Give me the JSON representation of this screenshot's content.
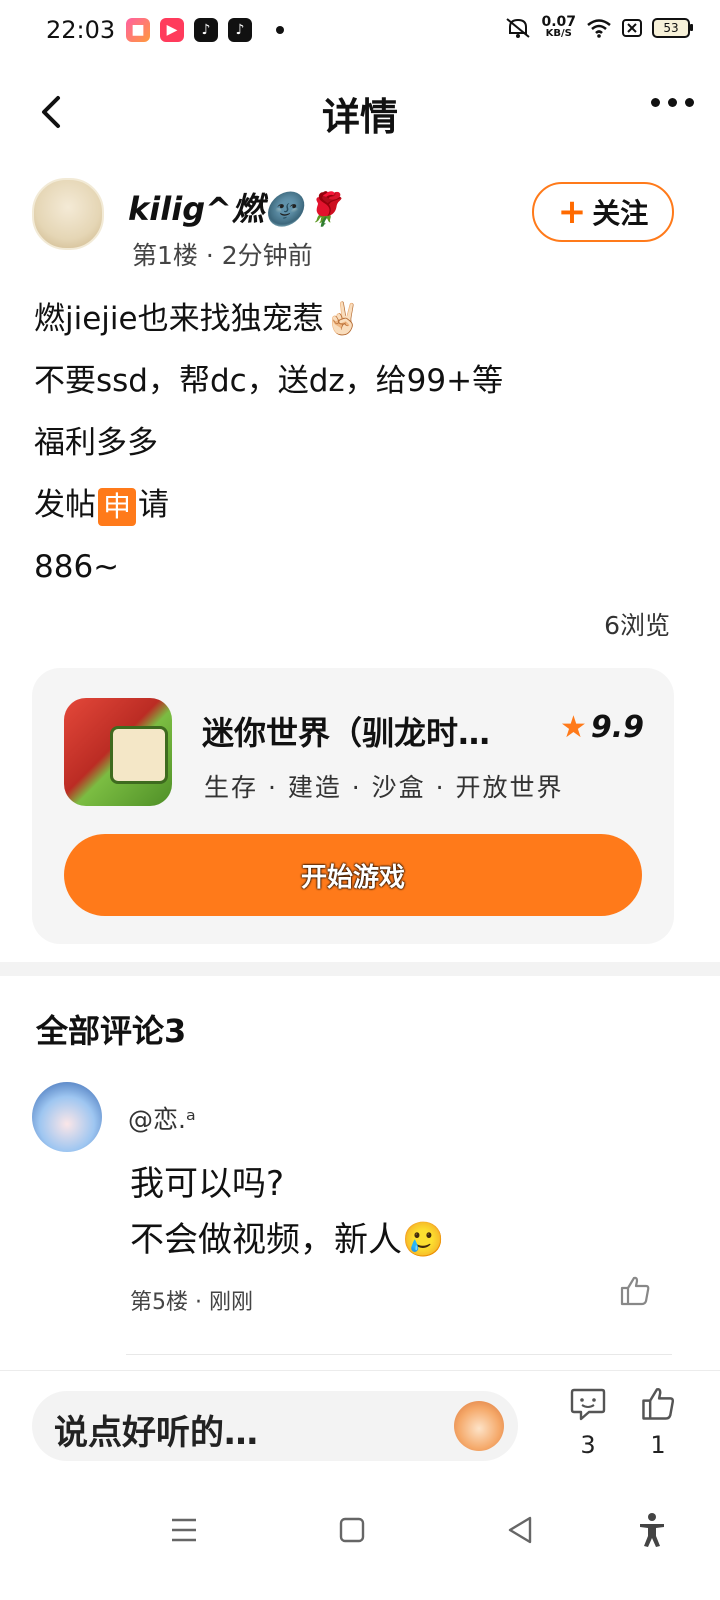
{
  "status_bar": {
    "time": "22:03",
    "app_icons": [
      "app-icon-1",
      "video-icon",
      "tiktok-icon",
      "tiktok-icon"
    ],
    "net_speed": "0.07",
    "net_unit": "KB/S",
    "battery": "53"
  },
  "header": {
    "title": "详情"
  },
  "post": {
    "author_name": "kilig^燃🌚🌹",
    "floor": "第1楼",
    "time": "2分钟前",
    "follow_label": "关注",
    "lines": [
      "燃jiejie也来找独宠惹✌🏻",
      "不要ssd，帮dc，送dz，给99+等",
      "福利多多",
      "886~"
    ],
    "line4_before": "发帖",
    "line4_badge": "申",
    "line4_after": "请",
    "views": "6浏览"
  },
  "game_card": {
    "name": "迷你世界（驯龙时…",
    "rating": "9.9",
    "tags": "生存 · 建造 · 沙盒 · 开放世界",
    "start_label": "开始游戏"
  },
  "comments": {
    "title": "全部评论3",
    "items": [
      {
        "name": "@恋.ᵃ",
        "text_line1": "我可以吗?",
        "text_line2": "不会做视频，新人🥲",
        "floor": "第5楼",
        "time": "刚刚"
      }
    ]
  },
  "bottom_bar": {
    "placeholder": "说点好听的…",
    "comment_count": "3",
    "like_count": "1"
  },
  "colors": {
    "accent": "#ff7a1a",
    "card_bg": "#f5f5f5"
  }
}
